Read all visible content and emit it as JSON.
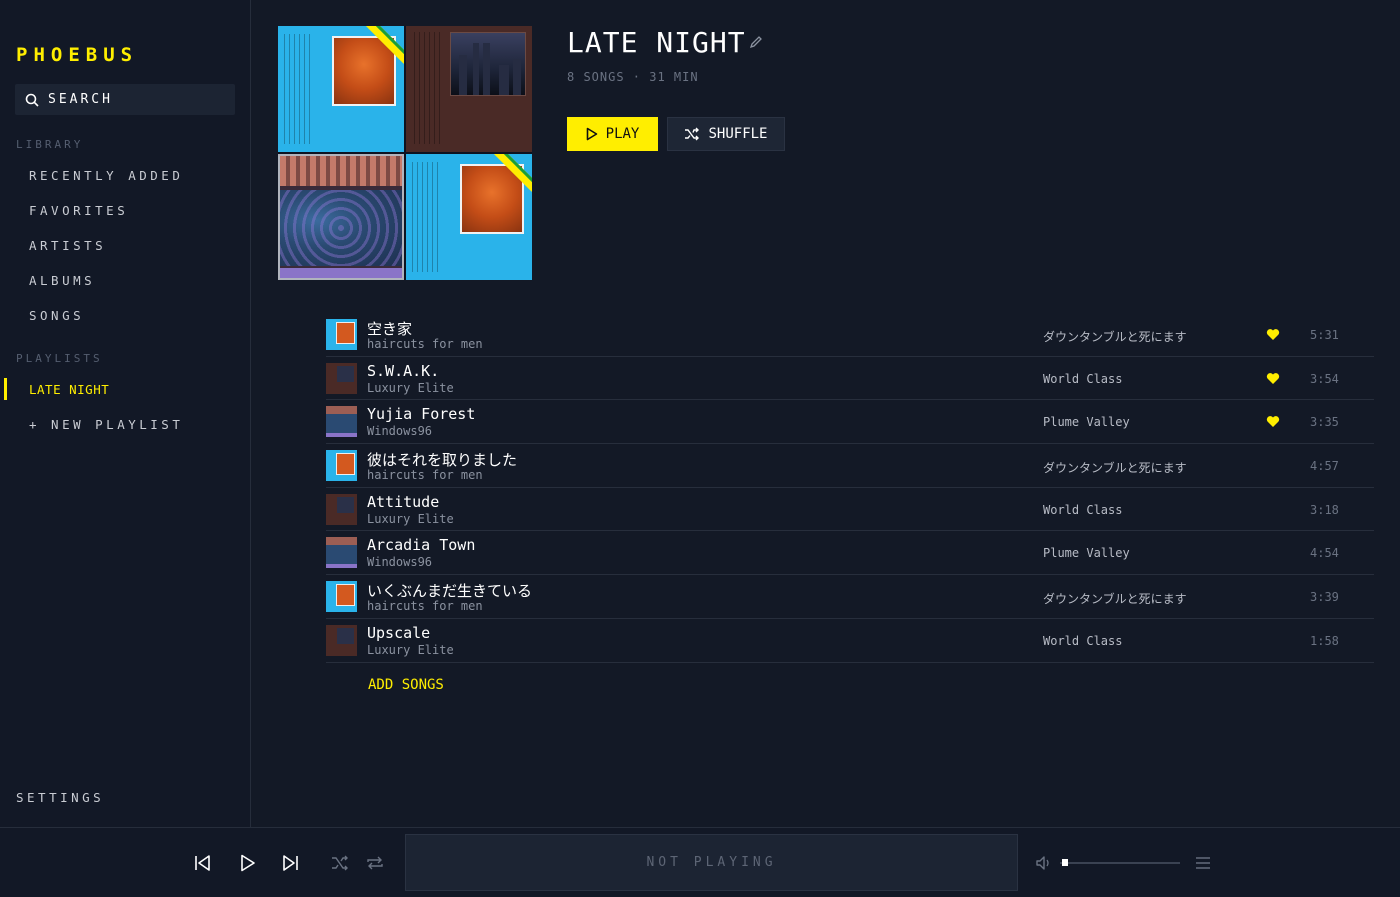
{
  "app": {
    "name": "PHOEBUS"
  },
  "sidebar": {
    "search_label": "SEARCH",
    "library_label": "LIBRARY",
    "library_items": [
      "RECENTLY ADDED",
      "FAVORITES",
      "ARTISTS",
      "ALBUMS",
      "SONGS"
    ],
    "playlists_label": "PLAYLISTS",
    "playlists": [
      "LATE NIGHT"
    ],
    "new_playlist": "+ NEW PLAYLIST",
    "settings": "SETTINGS"
  },
  "playlist": {
    "title": "LATE NIGHT",
    "meta": "8 SONGS · 31 MIN",
    "play_label": "PLAY",
    "shuffle_label": "SHUFFLE",
    "add_songs": "ADD SONGS"
  },
  "tracks": [
    {
      "title": "空き家",
      "artist": "haircuts for men",
      "album": "ダウンタンブルと死にます",
      "favorite": true,
      "duration": "5:31",
      "art": "haircuts"
    },
    {
      "title": "S.W.A.K.",
      "artist": "Luxury Elite",
      "album": "World Class",
      "favorite": true,
      "duration": "3:54",
      "art": "luxury"
    },
    {
      "title": "Yujia Forest",
      "artist": "Windows96",
      "album": "Plume Valley",
      "favorite": true,
      "duration": "3:35",
      "art": "windows"
    },
    {
      "title": "彼はそれを取りました",
      "artist": "haircuts for men",
      "album": "ダウンタンブルと死にます",
      "favorite": false,
      "duration": "4:57",
      "art": "haircuts"
    },
    {
      "title": "Attitude",
      "artist": "Luxury Elite",
      "album": "World Class",
      "favorite": false,
      "duration": "3:18",
      "art": "luxury"
    },
    {
      "title": "Arcadia Town",
      "artist": "Windows96",
      "album": "Plume Valley",
      "favorite": false,
      "duration": "4:54",
      "art": "windows"
    },
    {
      "title": "いくぶんまだ生きている",
      "artist": "haircuts for men",
      "album": "ダウンタンブルと死にます",
      "favorite": false,
      "duration": "3:39",
      "art": "haircuts"
    },
    {
      "title": "Upscale",
      "artist": "Luxury Elite",
      "album": "World Class",
      "favorite": false,
      "duration": "1:58",
      "art": "luxury"
    }
  ],
  "player": {
    "status": "NOT PLAYING",
    "volume": 0.02
  },
  "colors": {
    "accent": "#ffee00",
    "background": "#131926",
    "panel": "#1c2433"
  }
}
